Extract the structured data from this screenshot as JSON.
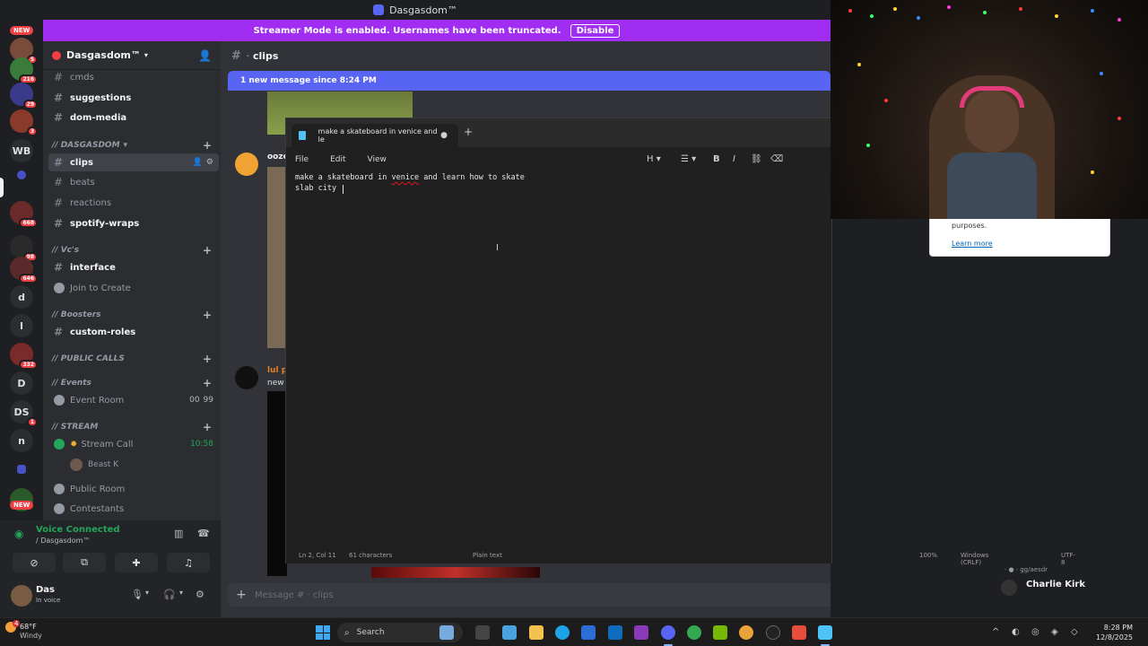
{
  "window": {
    "title": "Dasgasdom™"
  },
  "banner": {
    "message": "Streamer Mode is enabled. Usernames have been truncated.",
    "disable_label": "Disable"
  },
  "servers": [
    {
      "label": "",
      "badge": "5",
      "new": "NEW"
    },
    {
      "label": "",
      "badge": "216"
    },
    {
      "label": "",
      "badge": "29"
    },
    {
      "label": "",
      "badge": "3"
    },
    {
      "label": "WB",
      "badge": ""
    },
    {
      "label": "",
      "badge": ""
    },
    {
      "label": "",
      "badge": "668"
    },
    {
      "label": "",
      "badge": "98"
    },
    {
      "label": "",
      "badge": "646"
    },
    {
      "label": "d",
      "badge": ""
    },
    {
      "label": "l",
      "badge": ""
    },
    {
      "label": "",
      "badge": "332"
    },
    {
      "label": "D",
      "badge": ""
    },
    {
      "label": "DS",
      "badge": "1"
    },
    {
      "label": "n",
      "badge": ""
    },
    {
      "label": "",
      "badge": ""
    },
    {
      "label": "",
      "badge": "",
      "new": "NEW"
    }
  ],
  "sidebar": {
    "server_name": "Dasgasdom™",
    "channels": {
      "cmds": "cmds",
      "suggestions": "suggestions",
      "dom_media": "dom-media",
      "clips": "clips",
      "beats": "beats",
      "reactions": "reactions",
      "spotify_wraps": "spotify-wraps",
      "interface": "interface",
      "join_to_create": "Join to Create",
      "custom_roles": "custom-roles",
      "event_room": "Event Room",
      "event_room_count_a": "00",
      "event_room_count_b": "99",
      "stream_call": "Stream Call",
      "stream_call_time": "10:58",
      "stream_call_member": "Beast K",
      "public_room": "Public Room",
      "contestants": "Contestants"
    },
    "categories": {
      "dasgasdom": "// DASGASDOM",
      "vcs": "// Vc's",
      "boosters": "// Boosters",
      "public_calls": "// PUBLIC CALLS",
      "events": "// Events",
      "stream": "// STREAM"
    }
  },
  "voice": {
    "status": "Voice Connected",
    "server": "/ Dasgasdom™"
  },
  "user": {
    "name": "Das",
    "status": "In voice"
  },
  "chat": {
    "channel": "clips",
    "new_messages": "1 new message since 8:24 PM",
    "author1": "ooze",
    "author2": "lul p",
    "text2": "new",
    "placeholder": "Message # · clips"
  },
  "notepad": {
    "tab_title": "make a skateboard in venice and le",
    "menu": {
      "file": "File",
      "edit": "Edit",
      "view": "View"
    },
    "line1_pre": "make a skateboard in ",
    "line1_misspelled": "venice",
    "line1_post": " and learn how to skate",
    "line2": "slab city ",
    "status": {
      "position": "Ln 2, Col 11",
      "chars": "61 characters",
      "format": "Plain text",
      "zoom": "100%",
      "line_endings": "Windows (CRLF)",
      "encoding": "UTF-8"
    }
  },
  "popup": {
    "text": "purposes.",
    "link": "Learn more"
  },
  "members": {
    "top": "· ● · gg/aesdr",
    "name": "Charlie Kirk"
  },
  "taskbar": {
    "temperature": "68°F",
    "weather": "Windy",
    "weather_badge": "4",
    "search": "Search",
    "time": "8:28 PM",
    "date": "12/8/2025"
  }
}
